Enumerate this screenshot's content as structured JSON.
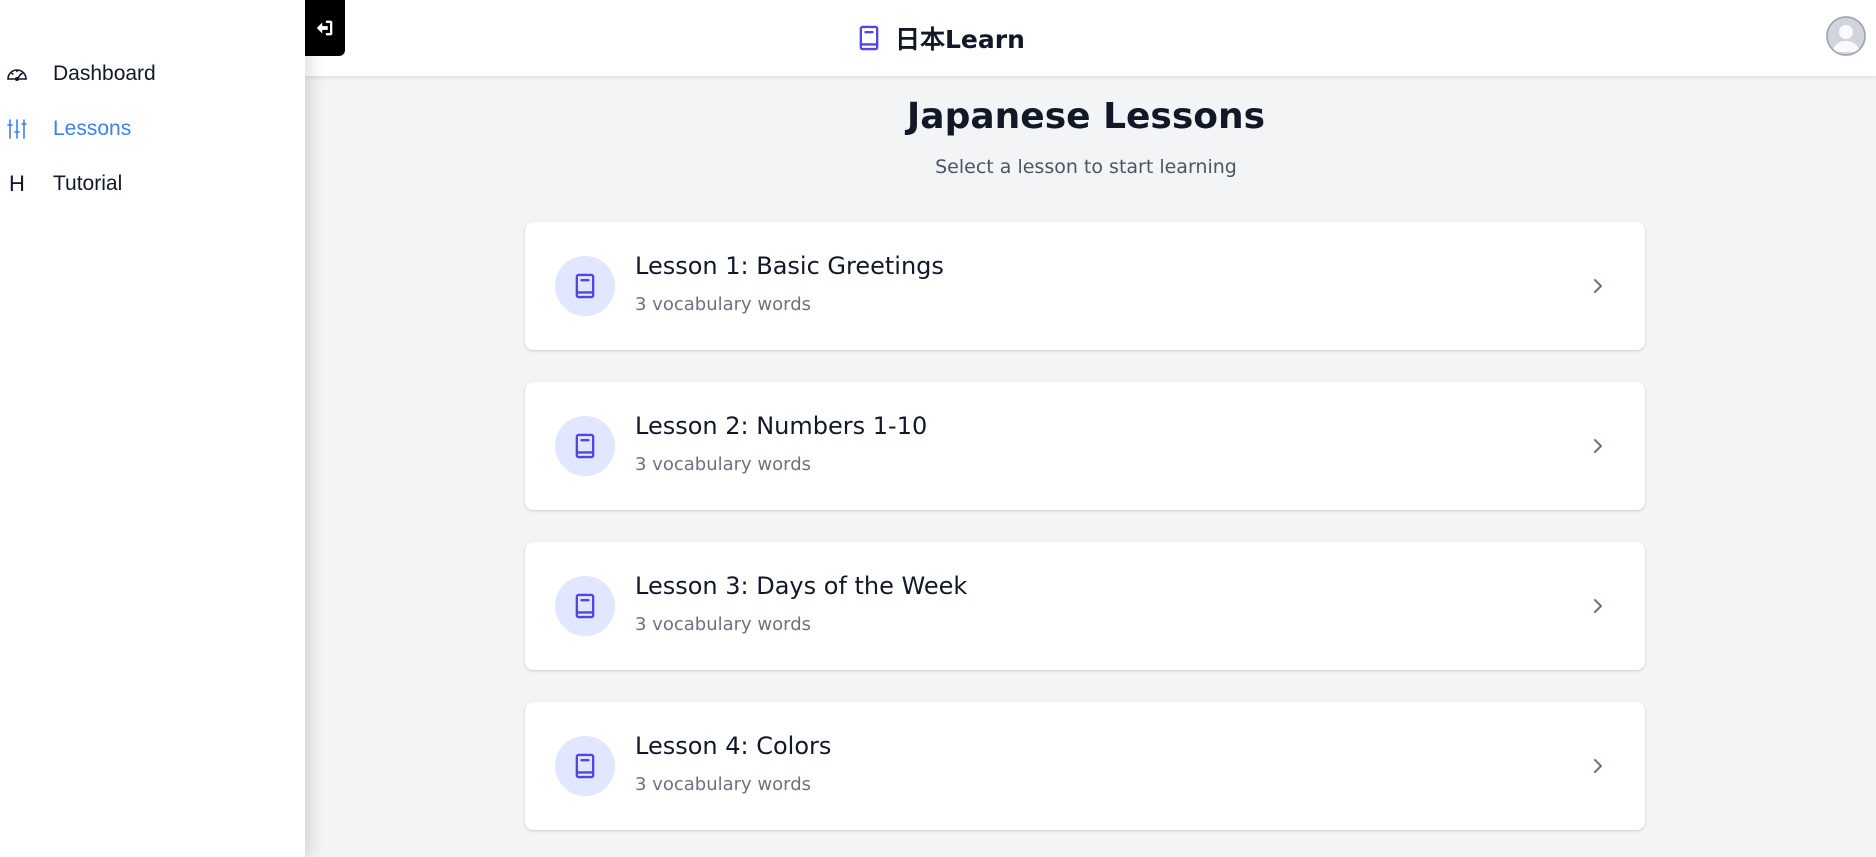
{
  "sidebar": {
    "items": [
      {
        "label": "Dashboard",
        "icon": "dashboard-gauge-icon",
        "active": false
      },
      {
        "label": "Lessons",
        "icon": "sliders-icon",
        "active": true
      },
      {
        "label": "Tutorial",
        "icon": "h-letter-icon",
        "glyph": "H",
        "active": false
      }
    ]
  },
  "header": {
    "brand": "日本Learn",
    "brand_icon": "book-icon",
    "avatar_icon": "user-avatar-icon"
  },
  "main": {
    "title": "Japanese Lessons",
    "subtitle": "Select a lesson to start learning",
    "lessons": [
      {
        "title": "Lesson 1: Basic Greetings",
        "meta": "3 vocabulary words"
      },
      {
        "title": "Lesson 2: Numbers 1-10",
        "meta": "3 vocabulary words"
      },
      {
        "title": "Lesson 3: Days of the Week",
        "meta": "3 vocabulary words"
      },
      {
        "title": "Lesson 4: Colors",
        "meta": "3 vocabulary words"
      }
    ]
  },
  "colors": {
    "accent": "#3b82f6",
    "indigo": "#4f46e5",
    "icon_bg": "#e0e7ff",
    "page_bg": "#f3f4f6"
  }
}
